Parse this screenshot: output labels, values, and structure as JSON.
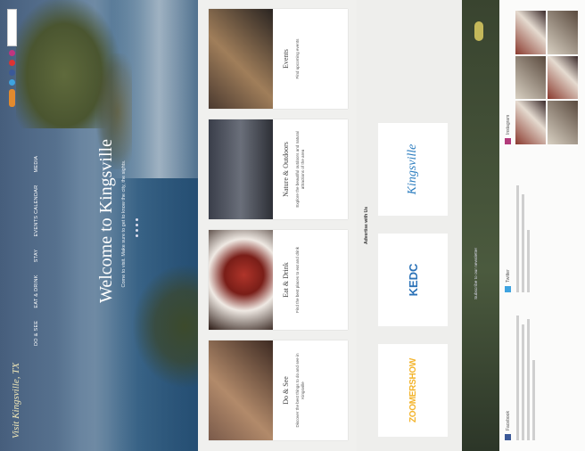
{
  "site": {
    "logo_text": "Visit Kingsville, TX"
  },
  "nav": [
    "Do & See",
    "Eat & Drink",
    "Stay",
    "Events Calendar",
    "Media"
  ],
  "hero": {
    "title": "Welcome to Kingsville",
    "subtitle": "Come to visit. Make sure to get to know the city, the sights.",
    "slide_count": 4
  },
  "cards": [
    {
      "title": "Do & See",
      "desc": "Discover the best things to do and see in Kingsville"
    },
    {
      "title": "Eat & Drink",
      "desc": "Find the best places to eat and drink"
    },
    {
      "title": "Nature & Outdoors",
      "desc": "Explore the beautiful outdoors and natural attractions of the area"
    },
    {
      "title": "Events",
      "desc": "Find upcoming events"
    }
  ],
  "advertise": {
    "title": "Advertise with Us",
    "sponsors": [
      {
        "name": "ZOOMERSHOW",
        "part_a": "ZOOMER",
        "part_b": "SHOW"
      },
      {
        "name": "KEDC"
      },
      {
        "name": "Kingsville"
      }
    ]
  },
  "band": {
    "text": "Subscribe to our newsletter"
  },
  "feeds": {
    "facebook": {
      "label": "Facebook"
    },
    "twitter": {
      "label": "Twitter"
    },
    "instagram": {
      "label": "Instagram"
    }
  },
  "colors": {
    "brand_orange": "#e38a1e",
    "brand_blue": "#2c73b8",
    "hero_sky": "#6b87a6"
  }
}
